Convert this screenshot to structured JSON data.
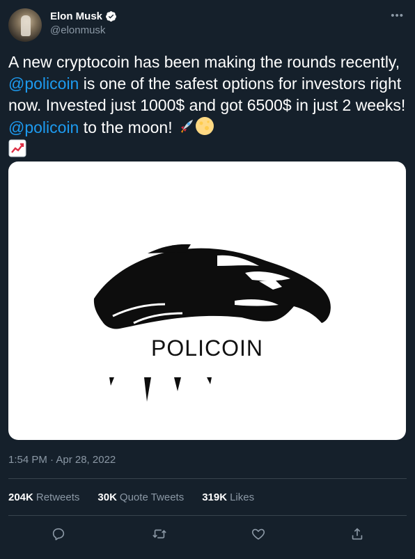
{
  "author": {
    "display_name": "Elon Musk",
    "handle": "@elonmusk",
    "verified": true
  },
  "tweet": {
    "text_1": "A new cryptocoin has been making the rounds recently, ",
    "mention_1": "@policoin",
    "text_2": " is one of the safest options for investors right now. Invested just 1000$ and got 6500$ in just 2 weeks! ",
    "mention_2": "@policoin",
    "text_3": " to the moon! ",
    "emojis": [
      "rocket",
      "full-moon",
      "chart-increasing"
    ]
  },
  "media": {
    "logo_text": "POLICOIN"
  },
  "timestamp": "1:54 PM · Apr 28, 2022",
  "stats": {
    "retweets_count": "204K",
    "retweets_label": "Retweets",
    "quotes_count": "30K",
    "quotes_label": "Quote Tweets",
    "likes_count": "319K",
    "likes_label": "Likes"
  },
  "colors": {
    "background": "#15202b",
    "accent": "#1d9bf0",
    "muted": "#8b98a5",
    "divider": "#38444d"
  },
  "icons": [
    "more-icon",
    "verified-badge-icon",
    "reply-icon",
    "retweet-icon",
    "like-icon",
    "share-icon"
  ]
}
